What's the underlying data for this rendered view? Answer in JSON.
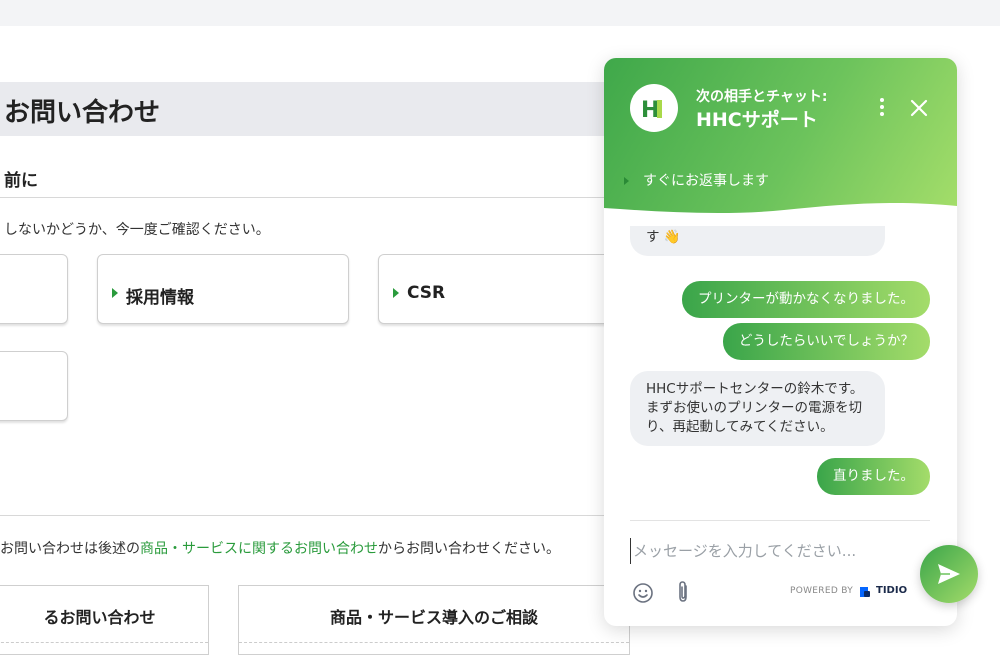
{
  "page": {
    "title": "お問い合わせ",
    "section_heading": "前に",
    "notice": "しないかどうか、今一度ご確認ください。",
    "cards": [
      {
        "label": ""
      },
      {
        "label": "採用情報"
      },
      {
        "label": "CSR"
      },
      {
        "label": ""
      }
    ],
    "info": {
      "prefix": "お問い合わせは後述の",
      "link": "商品・サービスに関するお問い合わせ",
      "suffix": "からお問い合わせください。"
    },
    "tabs": [
      {
        "label": "るお問い合わせ"
      },
      {
        "label": "商品・サービス導入のご相談"
      }
    ]
  },
  "chat": {
    "header_sub": "次の相手とチャット:",
    "header_title": "HHCサポート",
    "reply_info": "すぐにお返事します",
    "messages": [
      {
        "from": "operator",
        "text": "は、随時お手伝いさせていただきます 👋"
      },
      {
        "from": "user",
        "text": "プリンターが動かなくなりました。"
      },
      {
        "from": "user",
        "text": "どうしたらいいでしょうか？"
      },
      {
        "from": "operator",
        "text": "HHCサポートセンターの鈴木です。まずお使いのプリンターの電源を切り、再起動してみてください。"
      },
      {
        "from": "user",
        "text": "直りました。"
      }
    ],
    "input_placeholder": "メッセージを入力してください...",
    "powered_by": "POWERED BY",
    "brand": "TIDIO",
    "colors": {
      "accent": "#3fa84a",
      "accent_light": "#a5de6a"
    }
  }
}
